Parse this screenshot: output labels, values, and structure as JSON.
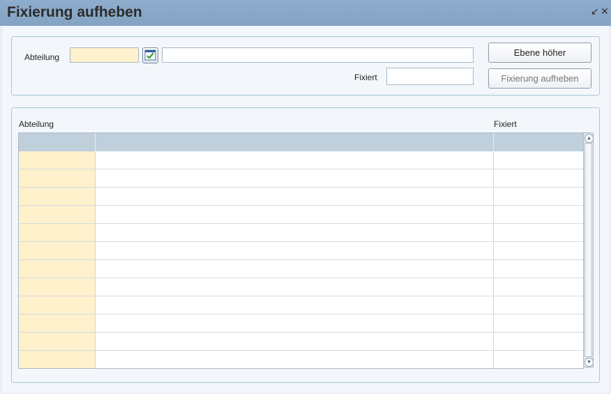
{
  "window": {
    "title": "Fixierung aufheben",
    "minimize_icon": "minimize-icon",
    "close_icon": "close-icon"
  },
  "form": {
    "abteilung_label": "Abteilung",
    "abteilung_code_value": "",
    "abteilung_name_value": "",
    "picker_icon": "calendar-check-icon",
    "fixiert_label": "Fixiert",
    "fixiert_value": "",
    "ebene_button": "Ebene höher",
    "fixierung_button": "Fixierung aufheben"
  },
  "table": {
    "columns": [
      "Abteilung",
      "",
      "Fixiert"
    ],
    "rows": [
      [
        "",
        "",
        ""
      ],
      [
        "",
        "",
        ""
      ],
      [
        "",
        "",
        ""
      ],
      [
        "",
        "",
        ""
      ],
      [
        "",
        "",
        ""
      ],
      [
        "",
        "",
        ""
      ],
      [
        "",
        "",
        ""
      ],
      [
        "",
        "",
        ""
      ],
      [
        "",
        "",
        ""
      ],
      [
        "",
        "",
        ""
      ],
      [
        "",
        "",
        ""
      ],
      [
        "",
        "",
        ""
      ]
    ]
  },
  "colors": {
    "titlebar": "#8fadcc",
    "input_highlight": "#fff1cc",
    "grid_header": "#bfcfdc"
  }
}
